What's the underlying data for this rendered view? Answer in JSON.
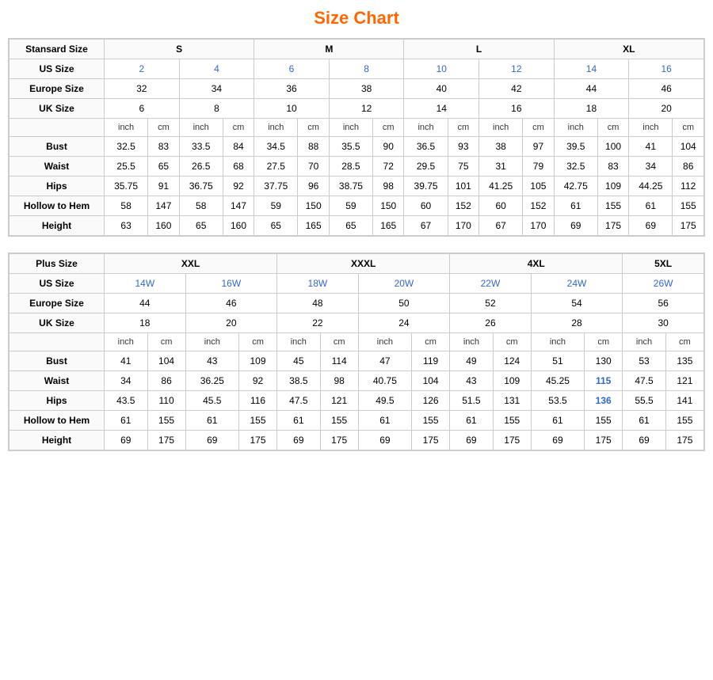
{
  "title": "Size Chart",
  "standard_table": {
    "size_row": [
      "S",
      "M",
      "L",
      "XL"
    ],
    "size_colspan": [
      2,
      2,
      2,
      2
    ],
    "us_size": [
      "2",
      "4",
      "6",
      "8",
      "10",
      "12",
      "14",
      "16"
    ],
    "europe_size": [
      "32",
      "34",
      "36",
      "38",
      "40",
      "42",
      "44",
      "46"
    ],
    "uk_size": [
      "6",
      "8",
      "10",
      "12",
      "14",
      "16",
      "18",
      "20"
    ],
    "units": [
      "inch",
      "cm",
      "inch",
      "cm",
      "inch",
      "cm",
      "inch",
      "cm",
      "inch",
      "cm",
      "inch",
      "cm",
      "inch",
      "cm",
      "inch",
      "cm"
    ],
    "bust": [
      "32.5",
      "83",
      "33.5",
      "84",
      "34.5",
      "88",
      "35.5",
      "90",
      "36.5",
      "93",
      "38",
      "97",
      "39.5",
      "100",
      "41",
      "104"
    ],
    "waist": [
      "25.5",
      "65",
      "26.5",
      "68",
      "27.5",
      "70",
      "28.5",
      "72",
      "29.5",
      "75",
      "31",
      "79",
      "32.5",
      "83",
      "34",
      "86"
    ],
    "hips": [
      "35.75",
      "91",
      "36.75",
      "92",
      "37.75",
      "96",
      "38.75",
      "98",
      "39.75",
      "101",
      "41.25",
      "105",
      "42.75",
      "109",
      "44.25",
      "112"
    ],
    "hollow_to_hem": [
      "58",
      "147",
      "58",
      "147",
      "59",
      "150",
      "59",
      "150",
      "60",
      "152",
      "60",
      "152",
      "61",
      "155",
      "61",
      "155"
    ],
    "height": [
      "63",
      "160",
      "65",
      "160",
      "65",
      "165",
      "65",
      "165",
      "67",
      "170",
      "67",
      "170",
      "69",
      "175",
      "69",
      "175"
    ]
  },
  "plus_table": {
    "size_row": [
      "XXL",
      "XXXL",
      "4XL",
      "5XL"
    ],
    "size_colspan": [
      2,
      2,
      2,
      1
    ],
    "us_size": [
      "14W",
      "16W",
      "18W",
      "20W",
      "22W",
      "24W",
      "26W"
    ],
    "europe_size": [
      "44",
      "46",
      "48",
      "50",
      "52",
      "54",
      "56"
    ],
    "uk_size": [
      "18",
      "20",
      "22",
      "24",
      "26",
      "28",
      "30"
    ],
    "units": [
      "inch",
      "cm",
      "inch",
      "cm",
      "inch",
      "cm",
      "inch",
      "cm",
      "inch",
      "cm",
      "inch",
      "cm",
      "inch",
      "cm"
    ],
    "bust": [
      "41",
      "104",
      "43",
      "109",
      "45",
      "114",
      "47",
      "119",
      "49",
      "124",
      "51",
      "130",
      "53",
      "135"
    ],
    "waist": [
      "34",
      "86",
      "36.25",
      "92",
      "38.5",
      "98",
      "40.75",
      "104",
      "43",
      "109",
      "45.25",
      "115",
      "47.5",
      "121"
    ],
    "hips": [
      "43.5",
      "110",
      "45.5",
      "116",
      "47.5",
      "121",
      "49.5",
      "126",
      "51.5",
      "131",
      "53.5",
      "136",
      "55.5",
      "141"
    ],
    "hollow_to_hem": [
      "61",
      "155",
      "61",
      "155",
      "61",
      "155",
      "61",
      "155",
      "61",
      "155",
      "61",
      "155",
      "61",
      "155"
    ],
    "height": [
      "69",
      "175",
      "69",
      "175",
      "69",
      "175",
      "69",
      "175",
      "69",
      "175",
      "69",
      "175",
      "69",
      "175"
    ]
  },
  "labels": {
    "stansard_size": "Stansard Size",
    "plus_size": "Plus Size",
    "us_size": "US Size",
    "europe_size": "Europe Size",
    "uk_size": "UK Size",
    "bust": "Bust",
    "waist": "Waist",
    "hips": "Hips",
    "hollow_to_hem": "Hollow to Hem",
    "height": "Height"
  }
}
